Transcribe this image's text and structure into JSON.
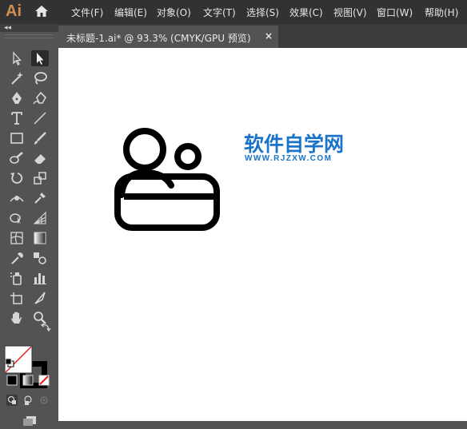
{
  "app": {
    "logo": "Ai"
  },
  "menu": [
    {
      "label": "文件(F)"
    },
    {
      "label": "编辑(E)"
    },
    {
      "label": "对象(O)"
    },
    {
      "label": "文字(T)"
    },
    {
      "label": "选择(S)"
    },
    {
      "label": "效果(C)"
    },
    {
      "label": "视图(V)"
    },
    {
      "label": "窗口(W)"
    },
    {
      "label": "帮助(H)"
    }
  ],
  "toolbar": {
    "collapse_label": "◂◂",
    "tools": [
      {
        "icon": "selection-tool-icon"
      },
      {
        "icon": "direct-selection-tool-icon",
        "selected": true
      },
      {
        "icon": "magic-wand-icon"
      },
      {
        "icon": "lasso-icon"
      },
      {
        "icon": "pen-tool-icon"
      },
      {
        "icon": "curvature-tool-icon"
      },
      {
        "icon": "type-tool-icon"
      },
      {
        "icon": "line-tool-icon"
      },
      {
        "icon": "rectangle-tool-icon"
      },
      {
        "icon": "paintbrush-icon"
      },
      {
        "icon": "blob-brush-icon"
      },
      {
        "icon": "eraser-icon"
      },
      {
        "icon": "rotate-tool-icon"
      },
      {
        "icon": "scale-tool-icon"
      },
      {
        "icon": "width-tool-icon"
      },
      {
        "icon": "puppet-warp-icon"
      },
      {
        "icon": "shape-builder-icon"
      },
      {
        "icon": "perspective-grid-icon"
      },
      {
        "icon": "mesh-tool-icon"
      },
      {
        "icon": "gradient-tool-icon"
      },
      {
        "icon": "eyedropper-icon"
      },
      {
        "icon": "blend-tool-icon"
      },
      {
        "icon": "symbol-sprayer-icon"
      },
      {
        "icon": "column-graph-icon"
      },
      {
        "icon": "artboard-tool-icon"
      },
      {
        "icon": "slice-tool-icon"
      },
      {
        "icon": "hand-tool-icon"
      },
      {
        "icon": "zoom-tool-icon"
      }
    ]
  },
  "colors": {
    "fill": "#ffffff",
    "stroke": "#000000",
    "none_slash": "#e02020",
    "watermark": "#1a73c6",
    "menubar": "#323232",
    "panel": "#535353"
  },
  "tab": {
    "title": "未标题-1.ai* @ 93.3% (CMYK/GPU 预览)",
    "close": "×"
  },
  "watermark": {
    "title": "软件自学网",
    "url": "WWW.RJZXW.COM"
  }
}
